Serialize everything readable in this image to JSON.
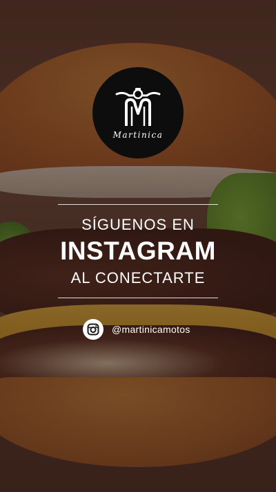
{
  "logo": {
    "brand_name": "Martinica"
  },
  "cta": {
    "line1": "SÍGUENOS EN",
    "line2": "INSTAGRAM",
    "line3": "AL CONECTARTE"
  },
  "social": {
    "icon": "instagram-icon",
    "handle": "@martinicamotos"
  },
  "colors": {
    "text": "#ffffff",
    "logo_bg": "#0d0d0d"
  }
}
